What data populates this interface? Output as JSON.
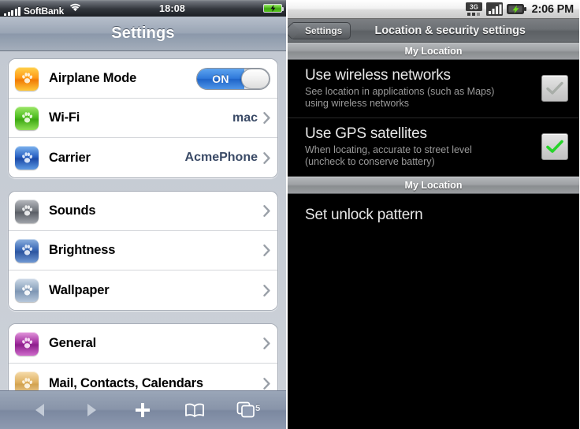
{
  "ios": {
    "statusbar": {
      "carrier": "SoftBank",
      "wifi_icon": "wifi-icon",
      "signal_icon": "signal-bars-icon",
      "time": "18:08",
      "battery_icon": "battery-charging-icon"
    },
    "navbar": {
      "title": "Settings"
    },
    "groups": [
      {
        "rows": [
          {
            "label": "Airplane Mode",
            "icon": "airplane-mode-icon",
            "icon_color": "#ff9b18",
            "control": "toggle",
            "toggle_state": "ON",
            "toggle_label": "ON"
          },
          {
            "label": "Wi-Fi",
            "icon": "wifi-settings-icon",
            "icon_color": "#4fbe22",
            "control": "disclosure",
            "value": "mac"
          },
          {
            "label": "Carrier",
            "icon": "carrier-icon",
            "icon_color": "#2b63c4",
            "control": "disclosure",
            "value": "AcmePhone"
          }
        ]
      },
      {
        "rows": [
          {
            "label": "Sounds",
            "icon": "sounds-icon",
            "icon_color": "#74787e",
            "control": "disclosure",
            "value": ""
          },
          {
            "label": "Brightness",
            "icon": "brightness-icon",
            "icon_color": "#3a68b5",
            "control": "disclosure",
            "value": ""
          },
          {
            "label": "Wallpaper",
            "icon": "wallpaper-icon",
            "icon_color": "#90a6c0",
            "control": "disclosure",
            "value": ""
          }
        ]
      },
      {
        "rows": [
          {
            "label": "General",
            "icon": "general-icon",
            "icon_color": "#a32fa0",
            "control": "disclosure",
            "value": ""
          },
          {
            "label": "Mail, Contacts, Calendars",
            "icon": "mail-contacts-calendars-icon",
            "icon_color": "#e0b263",
            "control": "disclosure",
            "value": ""
          }
        ]
      }
    ],
    "toolbar": {
      "back": "back-arrow-icon",
      "forward": "forward-arrow-icon",
      "add": "plus-icon",
      "bookmarks": "bookmarks-book-icon",
      "tabs": "tabs-pages-icon",
      "tabs_count": "5"
    }
  },
  "android": {
    "statusbar": {
      "network_icon": "3g-icon",
      "network_label": "3G",
      "signal_icon": "signal-bars-icon",
      "battery_icon": "battery-charging-icon",
      "time": "2:06 PM"
    },
    "titlebar": {
      "back_label": "Settings",
      "title": "Location & security settings"
    },
    "sections": [
      {
        "header": "My Location",
        "items": [
          {
            "title": "Use wireless networks",
            "subtitle": "See location in applications (such as Maps) using wireless networks",
            "checkbox": "checkbox-inactive",
            "checked": true,
            "check_color": "#a8ada8"
          },
          {
            "title": "Use GPS satellites",
            "subtitle": "When locating, accurate to street level (uncheck to conserve battery)",
            "checkbox": "checkbox-active",
            "checked": true,
            "check_color": "#27d42a"
          }
        ]
      },
      {
        "header": "My Location",
        "simple_items": [
          {
            "title": "Set unlock pattern"
          }
        ]
      }
    ]
  }
}
